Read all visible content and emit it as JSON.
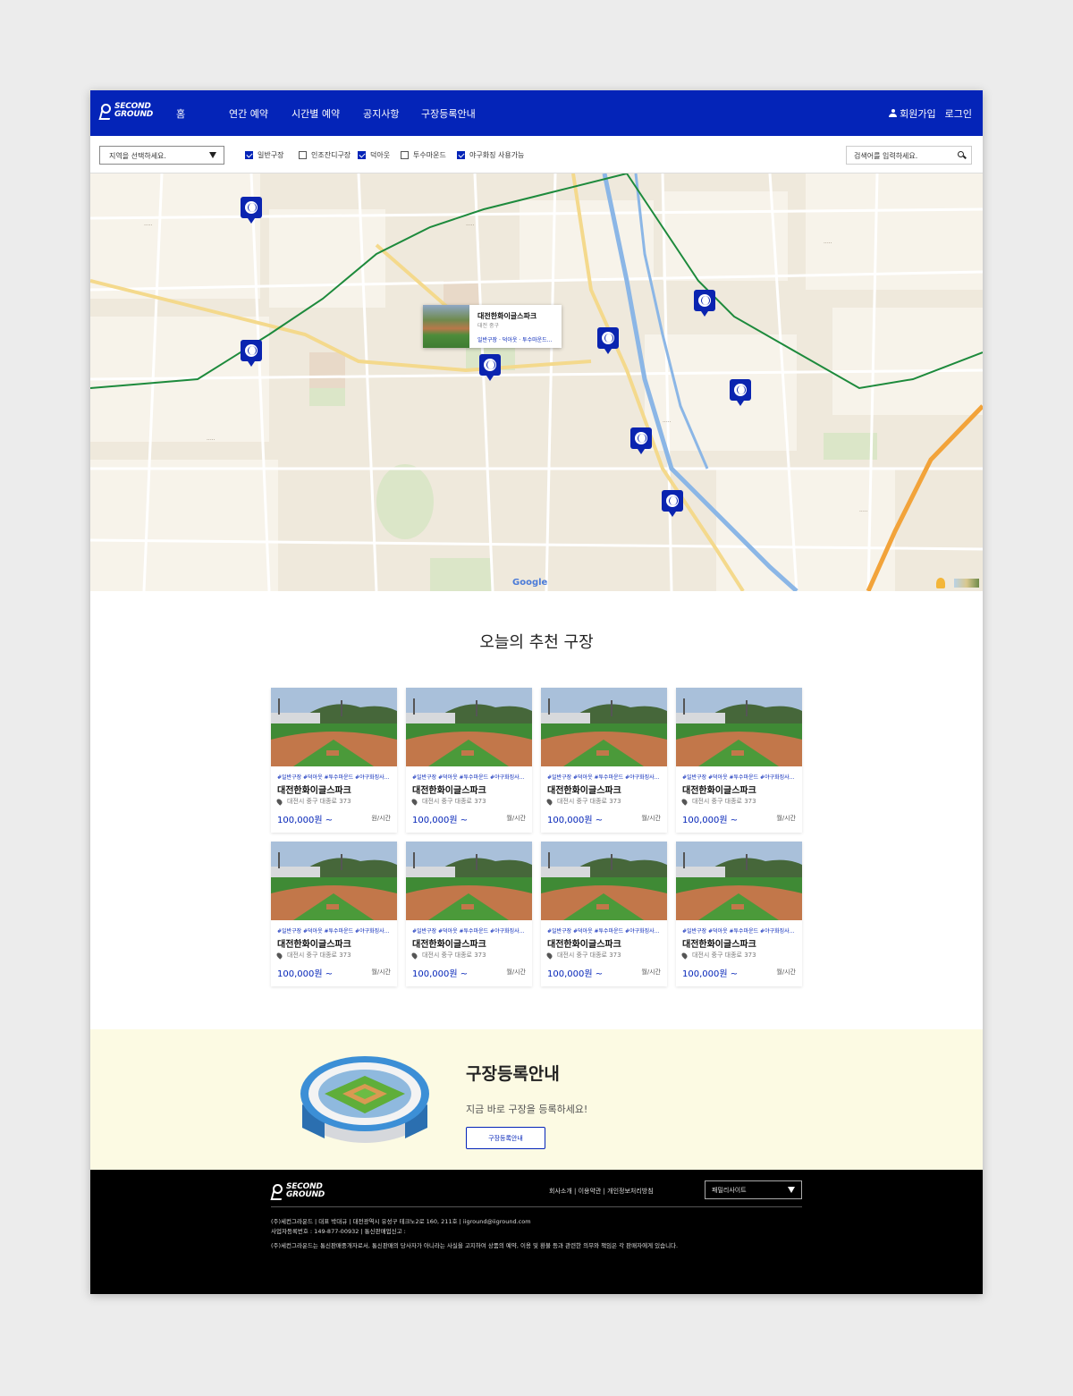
{
  "header": {
    "logo_line1": "SECOND",
    "logo_line2": "GROUND",
    "nav": [
      "홈",
      "연간 예약",
      "시간별 예약",
      "공지사항",
      "구장등록안내"
    ],
    "signup": "회원가입",
    "login": "로그인"
  },
  "filters": {
    "region_placeholder": "지역을 선택하세요.",
    "checkboxes": [
      {
        "label": "일반구장",
        "checked": true
      },
      {
        "label": "인조잔디구장",
        "checked": false
      },
      {
        "label": "덕아웃",
        "checked": true
      },
      {
        "label": "투수마운드",
        "checked": false
      },
      {
        "label": "야구화징 사용가능",
        "checked": true
      }
    ],
    "search_placeholder": "검색어를 입력하세요."
  },
  "map": {
    "popup": {
      "name": "대전한화이글스파크",
      "district": "대전 중구",
      "tags": "일반구장 · 덕아웃 · 투수마운드..."
    },
    "attribution": "Google",
    "pin_icon": "baseball-icon"
  },
  "recommend": {
    "title": "오늘의 추천 구장",
    "cards": [
      {
        "tags": "#일반구장 #덕아웃 #투수마운드 #야구화징사...",
        "name": "대전한화이글스파크",
        "address": "대전시 중구 대종로 373",
        "price": "100,000원 ~",
        "unit": "원/시간"
      },
      {
        "tags": "#일반구장 #덕아웃 #투수마운드 #야구화징사...",
        "name": "대전한화이글스파크",
        "address": "대전시 중구 대종로 373",
        "price": "100,000원 ~",
        "unit": "월/시간"
      },
      {
        "tags": "#일반구장 #덕아웃 #투수마운드 #야구화징사...",
        "name": "대전한화이글스파크",
        "address": "대전시 중구 대종로 373",
        "price": "100,000원 ~",
        "unit": "월/시간"
      },
      {
        "tags": "#일반구장 #덕아웃 #투수마운드 #야구화징사...",
        "name": "대전한화이글스파크",
        "address": "대전시 중구 대종로 373",
        "price": "100,000원 ~",
        "unit": "월/시간"
      },
      {
        "tags": "#일반구장 #덕아웃 #투수마운드 #야구화징사...",
        "name": "대전한화이글스파크",
        "address": "대전시 중구 대종로 373",
        "price": "100,000원 ~",
        "unit": "월/시간"
      },
      {
        "tags": "#일반구장 #덕아웃 #투수마운드 #야구화징사...",
        "name": "대전한화이글스파크",
        "address": "대전시 중구 대종로 373",
        "price": "100,000원 ~",
        "unit": "월/시간"
      },
      {
        "tags": "#일반구장 #덕아웃 #투수마운드 #야구화징사...",
        "name": "대전한화이글스파크",
        "address": "대전시 중구 대종로 373",
        "price": "100,000원 ~",
        "unit": "월/시간"
      },
      {
        "tags": "#일반구장 #덕아웃 #투수마운드 #야구화징사...",
        "name": "대전한화이글스파크",
        "address": "대전시 중구 대종로 373",
        "price": "100,000원 ~",
        "unit": "월/시간"
      }
    ]
  },
  "register": {
    "title": "구장등록안내",
    "subtitle": "지금 바로 구장을 등록하세요!",
    "button": "구장등록안내"
  },
  "footer": {
    "logo_line1": "SECOND",
    "logo_line2": "GROUND",
    "links": "회사소개   |   이용약관   |   개인정보처리방침",
    "family_site": "패밀리사이트",
    "info1": "(주)세컨그라운드  |  대표  박대규  |  대전광역시 유성구 테크노2로 160, 211호   |   iiground@iiground.com",
    "info2": "사업자등록번호 :  149-877-00932   |  통신판매업신고 :",
    "info3": "(주)세컨그라운드는 통신판매중개자로서, 통신판매의 당사자가 아니라는 사실을 고지하여 상품의 예약, 이용 및 환불 등과 관련한 의무와 책임은 각 판매자에게 있습니다."
  },
  "colors": {
    "brand": "#0424b8",
    "banner_bg": "#fcfae3",
    "footer_bg": "#000000"
  }
}
